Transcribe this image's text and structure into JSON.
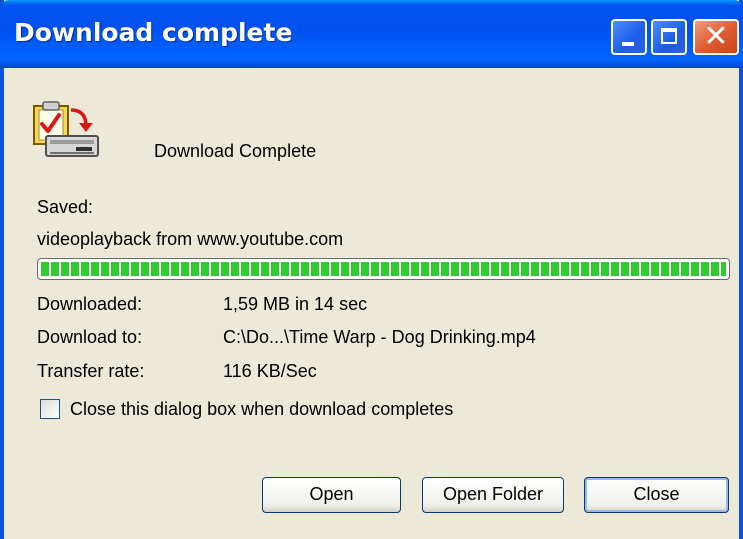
{
  "window": {
    "title": "Download complete"
  },
  "headline": "Download Complete",
  "saved": {
    "label": "Saved:",
    "source": "videoplayback from www.youtube.com"
  },
  "progress": {
    "percent": 100,
    "color": "#2fcb2f"
  },
  "details": [
    {
      "label": "Downloaded:",
      "value": "1,59 MB in 14 sec"
    },
    {
      "label": "Download to:",
      "value": "C:\\Do...\\Time Warp - Dog Drinking.mp4"
    },
    {
      "label": "Transfer rate:",
      "value": "116 KB/Sec"
    }
  ],
  "close_when_done": {
    "label": "Close this dialog box when download completes",
    "checked": false
  },
  "buttons": {
    "open": "Open",
    "open_folder": "Open Folder",
    "close": "Close"
  },
  "icons": {
    "titlebar": [
      "minimize-icon",
      "maximize-icon",
      "close-icon"
    ],
    "main": "download-complete-icon"
  },
  "colors": {
    "titlebar": "#0053ee",
    "window_bg": "#ece9d8",
    "close_button": "#de5a30"
  }
}
